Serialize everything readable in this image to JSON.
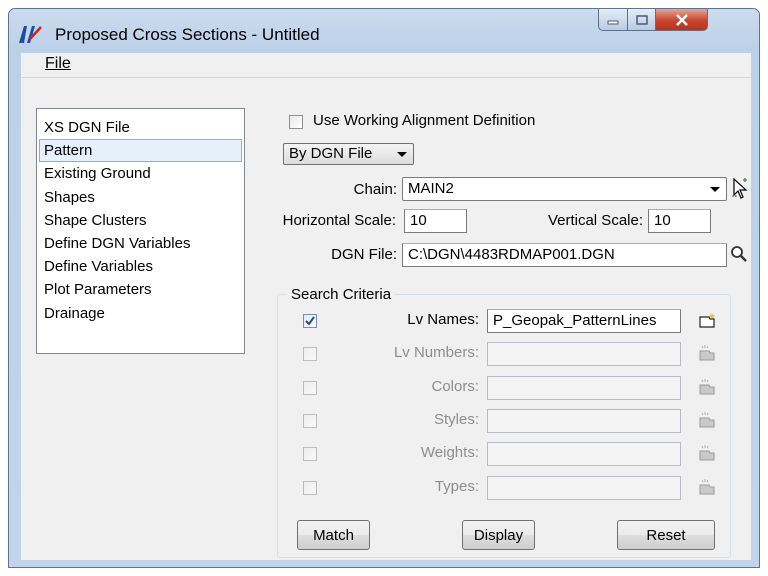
{
  "window": {
    "title": "Proposed Cross Sections - Untitled"
  },
  "menu": {
    "file_label": "File"
  },
  "nav": {
    "items": [
      {
        "label": "XS DGN File",
        "selected": false
      },
      {
        "label": "Pattern",
        "selected": true
      },
      {
        "label": "Existing Ground",
        "selected": false
      },
      {
        "label": "Shapes",
        "selected": false
      },
      {
        "label": "Shape Clusters",
        "selected": false
      },
      {
        "label": "Define DGN Variables",
        "selected": false
      },
      {
        "label": "Define Variables",
        "selected": false
      },
      {
        "label": "Plot Parameters",
        "selected": false
      },
      {
        "label": "Drainage",
        "selected": false
      }
    ]
  },
  "pattern": {
    "use_working_alignment_label": "Use Working Alignment Definition",
    "use_working_alignment_checked": false,
    "mode_selected": "By DGN File",
    "chain_label": "Chain:",
    "chain_value": "MAIN2",
    "hscale_label": "Horizontal Scale:",
    "hscale_value": "10",
    "vscale_label": "Vertical Scale:",
    "vscale_value": "10",
    "dgn_file_label": "DGN File:",
    "dgn_file_value": "C:\\DGN\\4483RDMAP001.DGN"
  },
  "search_criteria": {
    "title": "Search Criteria",
    "rows": [
      {
        "label": "Lv Names:",
        "value": "P_Geopak_PatternLines",
        "checked": true,
        "enabled": true
      },
      {
        "label": "Lv Numbers:",
        "value": "",
        "checked": false,
        "enabled": false
      },
      {
        "label": "Colors:",
        "value": "",
        "checked": false,
        "enabled": false
      },
      {
        "label": "Styles:",
        "value": "",
        "checked": false,
        "enabled": false
      },
      {
        "label": "Weights:",
        "value": "",
        "checked": false,
        "enabled": false
      },
      {
        "label": "Types:",
        "value": "",
        "checked": false,
        "enabled": false
      }
    ],
    "buttons": {
      "match": "Match",
      "display": "Display",
      "reset": "Reset"
    }
  },
  "icons": {
    "app": "geopak-logo-icon",
    "chain_pick": "cursor-select-icon",
    "file_browse": "magnifier-icon",
    "row_picker": "folder-star-icon"
  },
  "colors": {
    "titlebar": "#c2d4ea",
    "close_button": "#c9462e",
    "selection": "#e5f0fb"
  }
}
